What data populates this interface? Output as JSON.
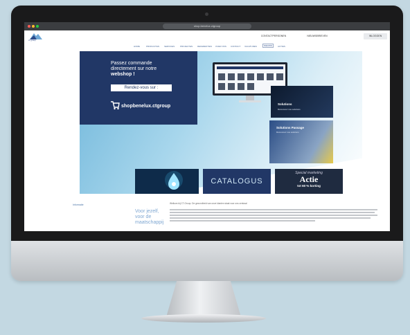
{
  "colors": {
    "navy": "#213766",
    "page_bg": "#c3d8e2",
    "light_blue": "#7fa7d2"
  },
  "browser": {
    "url": "shop.benelux.ctgroup",
    "icons": [
      "back-icon",
      "forward-icon",
      "refresh-icon",
      "close-icon"
    ]
  },
  "header": {
    "logo_text": "ct group",
    "buttons": [
      {
        "label": "CONTACTPERSONEN"
      },
      {
        "label": "NIEUWSBRIEVEN"
      },
      {
        "label": "INLOGGEN"
      }
    ]
  },
  "nav": {
    "items": [
      "HOME",
      "PRODUCTEN",
      "SERVICES",
      "PROJECTEN",
      "REFERENTIES",
      "OVER ONS",
      "CONTACT",
      "VACATURES",
      "NIEUWS",
      "ACTIES"
    ]
  },
  "hero": {
    "line1": "Passez commande",
    "line2": "directement sur notre",
    "line3": "webshop !",
    "button": "Rendez-vous sur :",
    "shop_url": "shopbenelux.ctgroup"
  },
  "cards": [
    {
      "title": "Solutions",
      "sub": "Découvrez nos solutions"
    },
    {
      "title": "Solutions Passage",
      "sub": "Découvrez nos solutions"
    }
  ],
  "tiles": {
    "catalogus": "CATALOGUS",
    "actie_top": "Special marketing",
    "actie_main": "Actie",
    "actie_sub": "tot 60 % korting"
  },
  "section": {
    "side_link": "Informatie",
    "heading": "Voor jezelf, voor de maatschappij",
    "intro": "Welkom bij CT-Group. De gezondheid van onze klanten staat voor ons centraal"
  }
}
